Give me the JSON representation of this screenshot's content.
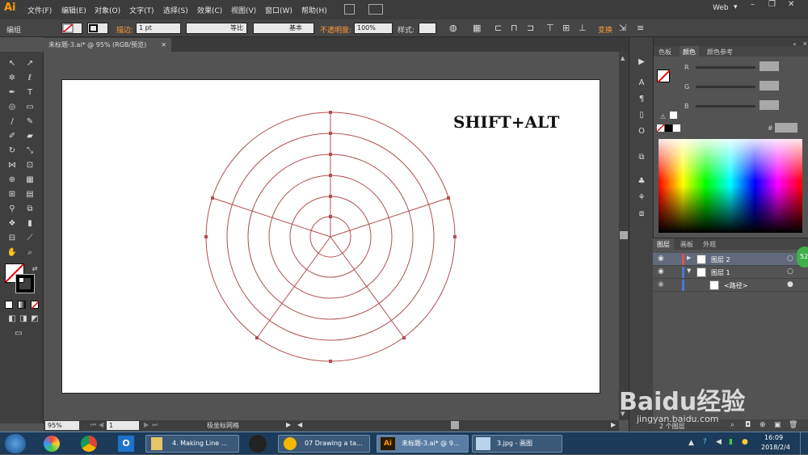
{
  "app": {
    "logo": "Ai",
    "workspace": "Web"
  },
  "menu": [
    "文件(F)",
    "编辑(E)",
    "对象(O)",
    "文字(T)",
    "选择(S)",
    "效果(C)",
    "视图(V)",
    "窗口(W)",
    "帮助(H)"
  ],
  "control": {
    "mode": "编组",
    "stroke_label": "描边:",
    "stroke_weight": "1 pt",
    "profile1": "等比",
    "profile2": "基本",
    "opacity_label": "不透明度:",
    "opacity_value": "100%",
    "style_label": "样式:",
    "transform": "变换"
  },
  "document": {
    "tab": "未标题-3.ai* @ 95% (RGB/预览)"
  },
  "artboard": {
    "text": "SHIFT+ALT"
  },
  "status": {
    "zoom": "95%",
    "page": "1",
    "tool": "极坐标网格"
  },
  "color_panel": {
    "tabs": [
      "色板",
      "颜色",
      "颜色参考"
    ],
    "r": "R",
    "g": "G",
    "b": "B",
    "hash": "#"
  },
  "layers_panel": {
    "tabs": [
      "图层",
      "画板",
      "外观"
    ],
    "layers": [
      {
        "name": "图层 2",
        "color": "#e05050"
      },
      {
        "name": "图层 1",
        "color": "#4a78d8"
      },
      {
        "name": "<路径>",
        "color": "#4a78d8"
      }
    ],
    "footer": "2 个图层"
  },
  "taskbar": {
    "tasks": [
      "4. Making Line ...",
      "07 Drawing a ta...",
      "未标题-3.ai* @ 9...",
      "3.jpg - 画图"
    ],
    "time": "16:09",
    "date": "2018/2/4"
  },
  "watermark": {
    "brand": "Baidu经验",
    "url": "jingyan.baidu.com"
  },
  "badge": "52"
}
